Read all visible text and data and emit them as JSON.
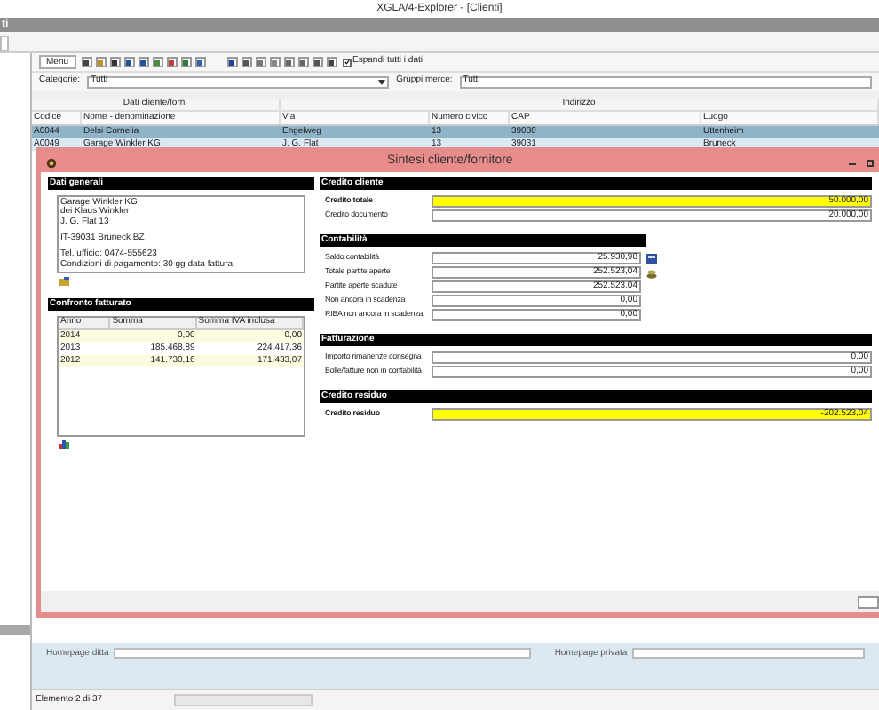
{
  "window": {
    "title": "XGLA/4-Explorer - [Clienti]"
  },
  "doc_tab": {
    "title": "ti"
  },
  "toolbar": {
    "menu": "Menu",
    "expand": {
      "label": "Espandi tutti i dati",
      "checked": true
    }
  },
  "filters": [
    {
      "label": "Categorie:",
      "value": "Tutti"
    },
    {
      "label": "Gruppi merce:",
      "value": "Tutti"
    }
  ],
  "table": {
    "groups": [
      "Dati cliente/forn.",
      "Indirizzo"
    ],
    "columns": [
      "Codice",
      "Nome - denominazione",
      "Via",
      "Numero civico",
      "CAP",
      "Luogo"
    ],
    "rows": [
      {
        "cells": [
          "A0044",
          "Delsi Cornelia",
          "Engelweg",
          "13",
          "39030",
          "Uttenheim"
        ],
        "selected": true
      },
      {
        "cells": [
          "A0049",
          "Garage Winkler KG",
          "J. G. Flat",
          "13",
          "39031",
          "Bruneck"
        ],
        "selected": false
      }
    ]
  },
  "dialog": {
    "title": "Sintesi cliente/fornitore",
    "general": {
      "title": "Dati generali",
      "blocks": [
        [
          "Garage Winkler KG",
          "dei Klaus Winkler",
          "J. G. Flat 13"
        ],
        [
          "IT-39031  Bruneck  BZ"
        ],
        [
          "Tel. ufficio: 0474-555623",
          "Condizioni di pagamento: 30 gg data fattura"
        ]
      ]
    },
    "turnover": {
      "title": "Confronto fatturato",
      "columns": [
        "Anno",
        "Somma",
        "Somma IVA inclusa"
      ],
      "rows": [
        [
          "2014",
          "0,00",
          "0,00"
        ],
        [
          "2013",
          "185.468,89",
          "224.417,36"
        ],
        [
          "2012",
          "141.730,16",
          "171.433,07"
        ]
      ]
    },
    "sections": [
      {
        "title": "Credito cliente",
        "kind": "wide",
        "rows": [
          {
            "label": "Credito totale",
            "value": "50.000,00",
            "highlight": true
          },
          {
            "label": "Credito documento",
            "value": "20.000,00",
            "highlight": false
          }
        ]
      },
      {
        "title": "Contabilità",
        "kind": "narrow",
        "rows": [
          {
            "label": "Saldo contabilità",
            "value": "25.930,98",
            "highlight": false
          },
          {
            "label": "Totale partite aperte",
            "value": "252.523,04",
            "highlight": false
          },
          {
            "label": "Partite aperte scadute",
            "value": "252.523,04",
            "highlight": false
          },
          {
            "label": "Non ancora in scadenza",
            "value": "0,00",
            "highlight": false
          },
          {
            "label": "RIBA non ancora in scadenza",
            "value": "0,00",
            "highlight": false
          }
        ]
      },
      {
        "title": "Fatturazione",
        "kind": "wide",
        "rows": [
          {
            "label": "Importo rimanenze consegna",
            "value": "0,00",
            "highlight": false
          },
          {
            "label": "Bolle/fatture non in contabilità",
            "value": "0,00",
            "highlight": false
          }
        ]
      },
      {
        "title": "Credito residuo",
        "kind": "wide",
        "rows": [
          {
            "label": "Credito residuo",
            "value": "-202.523,04",
            "highlight": true
          }
        ]
      }
    ]
  },
  "homepage": [
    {
      "label": "Homepage ditta"
    },
    {
      "label": "Homepage privata"
    }
  ],
  "status_bar": {
    "text": "Elemento 2 di 37"
  }
}
